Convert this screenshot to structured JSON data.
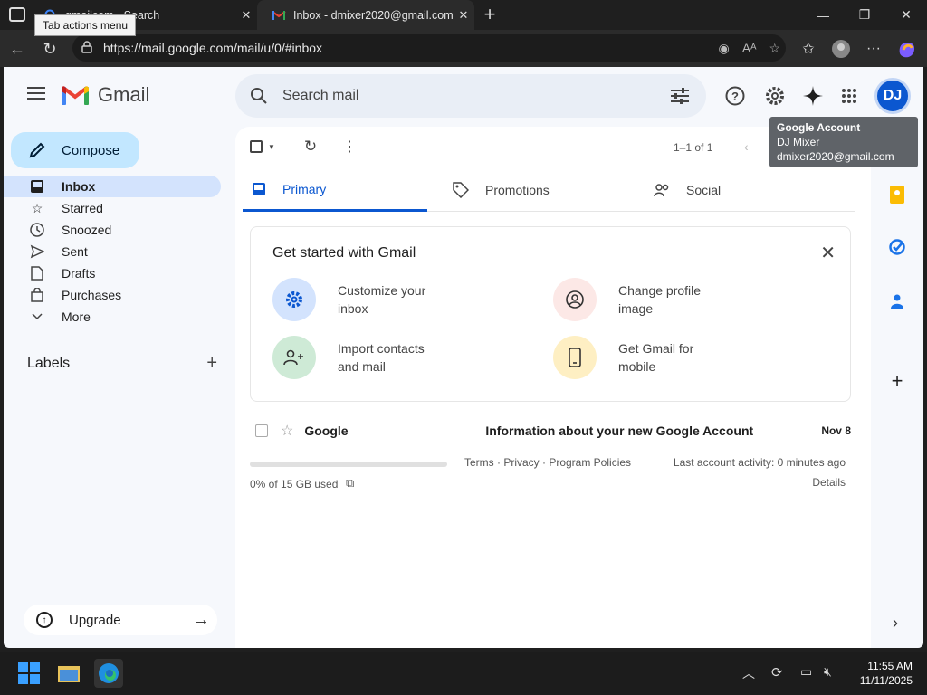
{
  "browser": {
    "tabs": [
      {
        "title": "gmailcom - Search",
        "active": false
      },
      {
        "title": "Inbox - dmixer2020@gmail.com -",
        "active": true
      }
    ],
    "tab_actions_tooltip": "Tab actions menu",
    "url": "https://mail.google.com/mail/u/0/#inbox"
  },
  "gmail": {
    "app_name": "Gmail",
    "search_placeholder": "Search mail",
    "avatar_initials": "DJ",
    "account_tooltip": {
      "heading": "Google Account",
      "name": "DJ Mixer",
      "email": "dmixer2020@gmail.com"
    },
    "compose_label": "Compose",
    "nav": [
      {
        "label": "Inbox",
        "icon": "inbox-icon",
        "active": true
      },
      {
        "label": "Starred",
        "icon": "star-icon"
      },
      {
        "label": "Snoozed",
        "icon": "clock-icon"
      },
      {
        "label": "Sent",
        "icon": "send-icon"
      },
      {
        "label": "Drafts",
        "icon": "draft-icon"
      },
      {
        "label": "Purchases",
        "icon": "bag-icon"
      },
      {
        "label": "More",
        "icon": "chevron-down-icon"
      }
    ],
    "labels_heading": "Labels",
    "upgrade_label": "Upgrade",
    "pagination": "1–1 of 1",
    "tabs": [
      {
        "label": "Primary"
      },
      {
        "label": "Promotions"
      },
      {
        "label": "Social"
      }
    ],
    "get_started": {
      "title": "Get started with Gmail",
      "items": [
        {
          "line1": "Customize your",
          "line2": "inbox",
          "icon": "gear-icon",
          "color": "#d3e3fd"
        },
        {
          "line1": "Change profile",
          "line2": "image",
          "icon": "profile-icon",
          "color": "#fce8e6"
        },
        {
          "line1": "Import contacts",
          "line2": "and mail",
          "icon": "add-people-icon",
          "color": "#ceead6"
        },
        {
          "line1": "Get Gmail for",
          "line2": "mobile",
          "icon": "phone-icon",
          "color": "#feefc3"
        }
      ]
    },
    "emails": [
      {
        "sender": "Google",
        "subject": "Information about your new Google Account",
        "date": "Nov 8"
      }
    ],
    "footer": {
      "storage": "0% of 15 GB used",
      "storage_fraction": 0.0,
      "links": "Terms · Privacy · Program Policies",
      "activity": "Last account activity: 0 minutes ago",
      "details": "Details"
    }
  },
  "taskbar": {
    "time": "11:55 AM",
    "date": "11/11/2025"
  },
  "colors": {
    "accent": "#0b57d0",
    "compose": "#c2e7ff",
    "nav_active": "#d3e3fd"
  }
}
